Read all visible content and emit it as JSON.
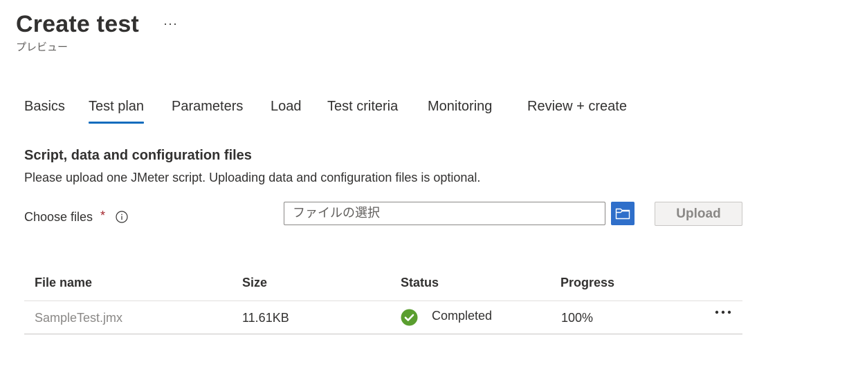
{
  "header": {
    "title": "Create test",
    "more_label": "···",
    "subtitle": "プレビュー"
  },
  "tabs": [
    {
      "label": "Basics",
      "active": false
    },
    {
      "label": "Test plan",
      "active": true
    },
    {
      "label": "Parameters",
      "active": false
    },
    {
      "label": "Load",
      "active": false
    },
    {
      "label": "Test criteria",
      "active": false
    },
    {
      "label": "Monitoring",
      "active": false
    },
    {
      "label": "Review + create",
      "active": false
    }
  ],
  "section": {
    "title": "Script, data and configuration files",
    "description": "Please upload one JMeter script. Uploading data and configuration files is optional."
  },
  "choose_files": {
    "label": "Choose files",
    "required_marker": "*",
    "info_icon": "info-icon",
    "placeholder": "ファイルの選択",
    "browse_icon": "folder-icon",
    "upload_label": "Upload"
  },
  "table": {
    "columns": [
      "File name",
      "Size",
      "Status",
      "Progress"
    ],
    "rows": [
      {
        "file_name": "SampleTest.jmx",
        "size": "11.61KB",
        "status": "Completed",
        "status_icon": "check-circle-icon",
        "progress": "100%",
        "more_icon": "more-icon"
      }
    ]
  },
  "colors": {
    "accent": "#0f6cbd",
    "browse_button": "#2f6fca",
    "success": "#5a9e2f",
    "required": "#a4262c"
  }
}
